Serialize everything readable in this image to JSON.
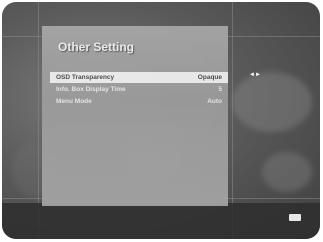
{
  "screen": {
    "title": "Other Setting",
    "nav_hint": "◄►",
    "bottom_icon": "exit-icon"
  },
  "menu": {
    "items": [
      {
        "label": "OSD Transparency",
        "value": "Opaque",
        "selected": true
      },
      {
        "label": "Info. Box Display Time",
        "value": "5",
        "selected": false
      },
      {
        "label": "Menu Mode",
        "value": "Auto",
        "selected": false
      }
    ]
  },
  "colors": {
    "panel": "#a4a4a4",
    "highlight": "#f2f2f2",
    "text": "#ececec",
    "background": "#5a5a5a"
  }
}
